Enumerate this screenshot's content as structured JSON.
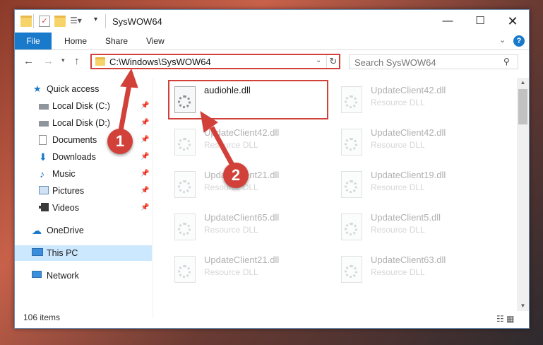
{
  "window": {
    "title": "SysWOW64"
  },
  "ribbon": {
    "file": "File",
    "home": "Home",
    "share": "Share",
    "view": "View"
  },
  "address": {
    "path": "C:\\Windows\\SysWOW64"
  },
  "search": {
    "placeholder": "Search SysWOW64"
  },
  "sidebar": {
    "quick_access": "Quick access",
    "items": [
      "Local Disk (C:)",
      "Local Disk (D:)",
      "Documents",
      "Downloads",
      "Music",
      "Pictures",
      "Videos"
    ],
    "onedrive": "OneDrive",
    "this_pc": "This PC",
    "network": "Network"
  },
  "files": [
    {
      "name": "audiohle.dll",
      "type": ""
    },
    {
      "name": "UpdateClient42.dll",
      "type": "Resource DLL"
    },
    {
      "name": "UpdateClient42.dll",
      "type": "Resource DLL"
    },
    {
      "name": "UpdateClient42.dll",
      "type": "Resource DLL"
    },
    {
      "name": "UpdateClient21.dll",
      "type": "Resource DLL"
    },
    {
      "name": "UpdateClient19.dll",
      "type": "Resource DLL"
    },
    {
      "name": "UpdateClient65.dll",
      "type": "Resource DLL"
    },
    {
      "name": "UpdateClient5.dll",
      "type": "Resource DLL"
    },
    {
      "name": "UpdateClient21.dll",
      "type": "Resource DLL"
    },
    {
      "name": "UpdateClient63.dll",
      "type": "Resource DLL"
    }
  ],
  "status": {
    "count": "106 items"
  },
  "annotations": {
    "step1": "1",
    "step2": "2",
    "color": "#d2403a"
  }
}
